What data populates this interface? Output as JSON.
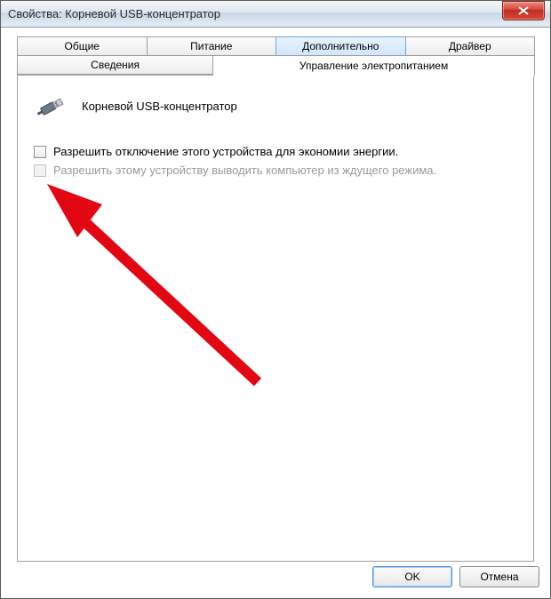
{
  "window": {
    "title": "Свойства: Корневой USB-концентратор"
  },
  "tabs": {
    "row1": [
      "Общие",
      "Питание",
      "Дополнительно",
      "Драйвер"
    ],
    "row2": [
      "Сведения",
      "Управление электропитанием"
    ],
    "active_row1_index": 2,
    "active_row2_index": 1
  },
  "device": {
    "name": "Корневой USB-концентратор",
    "icon": "usb-plug-icon"
  },
  "options": {
    "allow_power_off": {
      "label": "Разрешить отключение этого устройства для экономии энергии.",
      "checked": false,
      "enabled": true
    },
    "allow_wake": {
      "label": "Разрешить этому устройству выводить компьютер из ждущего режима.",
      "checked": false,
      "enabled": false
    }
  },
  "buttons": {
    "ok": "OK",
    "cancel": "Отмена"
  },
  "annotation": {
    "type": "arrow",
    "color": "#e30613"
  }
}
